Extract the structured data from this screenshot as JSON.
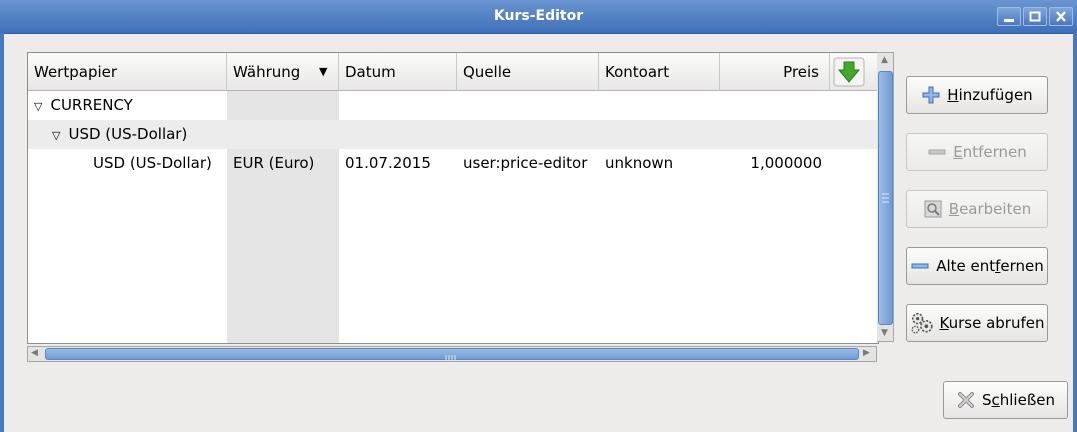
{
  "window": {
    "title": "Kurs-Editor",
    "controls": [
      "minimize-icon",
      "maximize-icon",
      "close-icon"
    ]
  },
  "table": {
    "columns": [
      "Wertpapier",
      "Währung",
      "Datum",
      "Quelle",
      "Kontoart",
      "Preis"
    ],
    "sorted_column": "Währung",
    "sort_icon": "green-down-arrow-icon",
    "rows": [
      {
        "level": 0,
        "expanded": true,
        "wertpapier": "CURRENCY",
        "waehrung": "",
        "datum": "",
        "quelle": "",
        "kontoart": "",
        "preis": ""
      },
      {
        "level": 1,
        "expanded": true,
        "wertpapier": "USD (US-Dollar)",
        "waehrung": "",
        "datum": "",
        "quelle": "",
        "kontoart": "",
        "preis": ""
      },
      {
        "level": 2,
        "expanded": false,
        "wertpapier": "USD (US-Dollar)",
        "waehrung": "EUR (Euro)",
        "datum": "01.07.2015",
        "quelle": "user:price-editor",
        "kontoart": "unknown",
        "preis": "1,000000"
      }
    ]
  },
  "buttons": {
    "add": {
      "label_pre": "",
      "mnemonic": "H",
      "label_post": "inzufügen",
      "icon": "plus-icon",
      "enabled": true
    },
    "remove": {
      "label_pre": "",
      "mnemonic": "E",
      "label_post": "ntfernen",
      "icon": "minus-icon",
      "enabled": false
    },
    "edit": {
      "label_pre": "",
      "mnemonic": "B",
      "label_post": "earbeiten",
      "icon": "edit-icon",
      "enabled": false
    },
    "remove_old": {
      "label_pre": "Alte ent",
      "mnemonic": "f",
      "label_post": "ernen",
      "icon": "minus-icon",
      "enabled": true
    },
    "fetch": {
      "label_pre": "",
      "mnemonic": "K",
      "label_post": "urse abrufen",
      "icon": "gears-icon",
      "enabled": true
    },
    "close": {
      "label_pre": "S",
      "mnemonic": "c",
      "label_post": "hließen",
      "icon": "close-x-icon",
      "enabled": true
    }
  }
}
